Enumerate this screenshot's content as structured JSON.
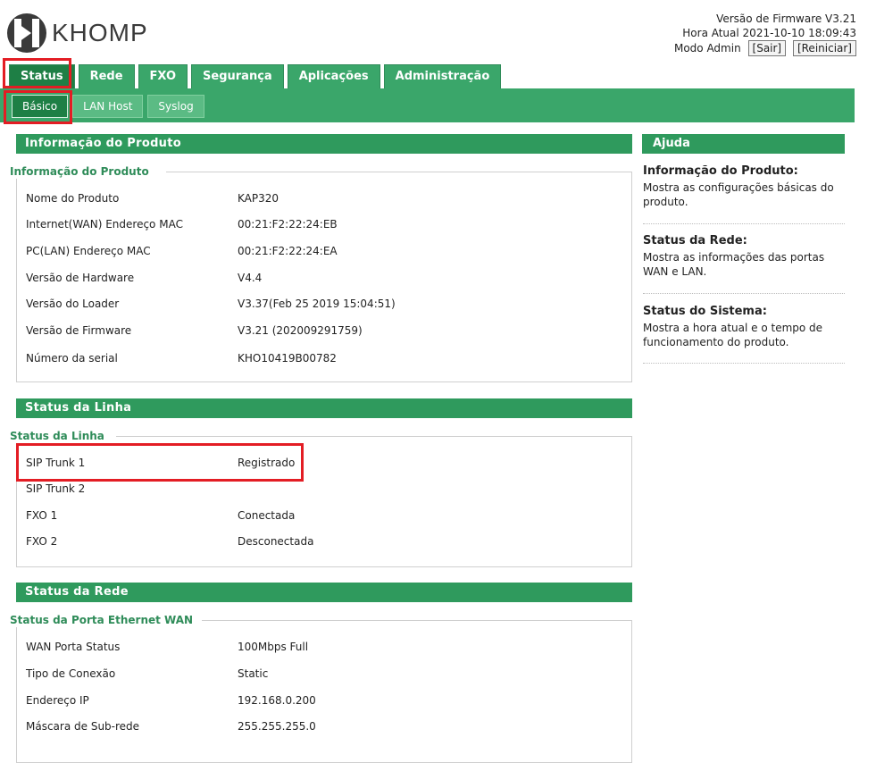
{
  "header": {
    "brand": "KHOMP",
    "firmware_line": "Versão de Firmware V3.21",
    "time_line": "Hora Atual 2021-10-10 18:09:43",
    "mode_label": "Modo Admin",
    "logout_label": "[Sair]",
    "restart_label": "[Reiniciar]"
  },
  "tabs": [
    {
      "label": "Status",
      "active": true
    },
    {
      "label": "Rede"
    },
    {
      "label": "FXO"
    },
    {
      "label": "Segurança"
    },
    {
      "label": "Aplicações"
    },
    {
      "label": "Administração"
    }
  ],
  "subtabs": [
    {
      "label": "Básico",
      "active": true
    },
    {
      "label": "LAN Host"
    },
    {
      "label": "Syslog"
    }
  ],
  "product": {
    "bar_title": "Informação do Produto",
    "legend": "Informação do Produto",
    "rows": [
      {
        "key": "Nome do Produto",
        "value": "KAP320"
      },
      {
        "key": "Internet(WAN) Endereço MAC",
        "value": "00:21:F2:22:24:EB"
      },
      {
        "key": "PC(LAN) Endereço MAC",
        "value": "00:21:F2:22:24:EA"
      },
      {
        "key": "Versão de Hardware",
        "value": "V4.4"
      },
      {
        "key": "Versão do Loader",
        "value": "V3.37(Feb 25 2019 15:04:51)"
      },
      {
        "key": "Versão de Firmware",
        "value": "V3.21 (202009291759)"
      },
      {
        "key": "Número da serial",
        "value": "KHO10419B00782"
      }
    ]
  },
  "line_status": {
    "bar_title": "Status da Linha",
    "legend": "Status da Linha",
    "rows": [
      {
        "key": "SIP Trunk 1",
        "value": "Registrado"
      },
      {
        "key": "SIP Trunk 2",
        "value": ""
      },
      {
        "key": "FXO 1",
        "value": "Conectada"
      },
      {
        "key": "FXO 2",
        "value": "Desconectada"
      }
    ]
  },
  "network": {
    "bar_title": "Status da Rede",
    "legend": "Status da Porta Ethernet WAN",
    "rows": [
      {
        "key": "WAN Porta Status",
        "value": "100Mbps Full"
      },
      {
        "key": "Tipo de Conexão",
        "value": "Static"
      },
      {
        "key": "Endereço IP",
        "value": "192.168.0.200"
      },
      {
        "key": "Máscara de Sub-rede",
        "value": "255.255.255.0"
      }
    ]
  },
  "help": {
    "title": "Ajuda",
    "items": [
      {
        "title": "Informação do Produto:",
        "text": "Mostra as configurações básicas do produto."
      },
      {
        "title": "Status da Rede:",
        "text": "Mostra as informações das portas WAN e LAN."
      },
      {
        "title": "Status do Sistema:",
        "text": "Mostra a hora atual e o tempo de funcionamento do produto."
      }
    ]
  },
  "colors": {
    "green": "#3aa66a",
    "dark_green": "#1e7f45",
    "highlight": "#e31d24"
  }
}
